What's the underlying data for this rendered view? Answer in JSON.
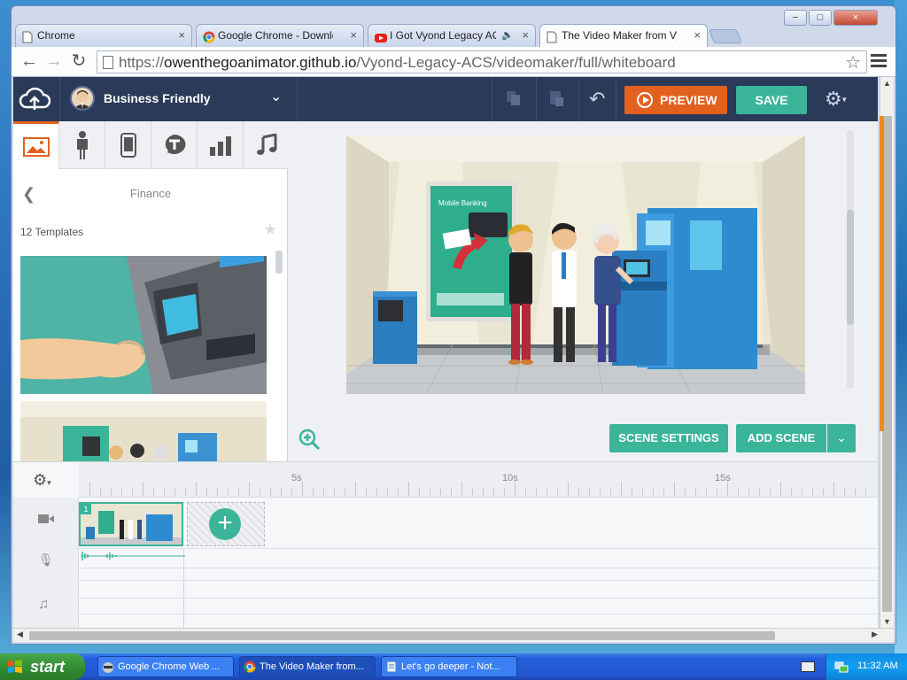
{
  "browser": {
    "window_controls": [
      "−",
      "□",
      "×"
    ],
    "tabs": [
      {
        "title": "Chrome",
        "icon": "page-icon",
        "close": "×"
      },
      {
        "title": "Google Chrome - Download t",
        "icon": "chrome-icon",
        "close": "×"
      },
      {
        "title": "I Got Vyond Legacy ACS",
        "icon": "youtube-icon",
        "close": "×",
        "audio": "🔈"
      },
      {
        "title": "The Video Maker from Vyo",
        "icon": "page-icon",
        "close": "×"
      }
    ],
    "url_prefix": "https://",
    "url_host": "owenthegoanimator.github.io",
    "url_path": "/Vyond-Legacy-ACS/videomaker/full/whiteboard",
    "back": "←",
    "forward": "→",
    "reload": "↻",
    "star": "☆"
  },
  "header": {
    "theme_name": "Business Friendly",
    "chevron": "⌄",
    "undo": "↶",
    "preview_label": "PREVIEW",
    "save_label": "SAVE",
    "settings_icon": "⚙",
    "settings_caret": "▾"
  },
  "left_panel": {
    "tabs": [
      "props-icon",
      "character-icon",
      "phone-icon",
      "text-bubble-icon",
      "chart-icon",
      "music-icon"
    ],
    "back": "❮",
    "category": "Finance",
    "template_count": "12 Templates",
    "star": "★"
  },
  "stage": {
    "scene_settings_label": "SCENE SETTINGS",
    "add_scene_label": "ADD SCENE",
    "dropdown": "⌄",
    "poster_title": "Mobile Banking"
  },
  "timeline": {
    "settings_icon": "⚙",
    "settings_caret": "▾",
    "ticks": [
      "5s",
      "10s",
      "15s"
    ],
    "scene_number": "1",
    "add": "+",
    "track_icons": [
      "video-camera-icon",
      "microphone-icon",
      "music-note-icon"
    ],
    "mic": "🎙",
    "music": "♫"
  },
  "scrollbars": {
    "up": "▲",
    "down": "▼",
    "left": "◀",
    "right": "▶"
  },
  "taskbar": {
    "start_label": "start",
    "items": [
      {
        "label": "Google Chrome Web ...",
        "icon": "raccoon-icon"
      },
      {
        "label": "The Video Maker from...",
        "icon": "chrome-icon"
      },
      {
        "label": "Let's go deeper - Not...",
        "icon": "notepad-icon"
      }
    ],
    "clock": "11:32 AM"
  },
  "colors": {
    "header": "#2a3a58",
    "accent_orange": "#e2611f",
    "accent_green": "#3bb59a"
  }
}
